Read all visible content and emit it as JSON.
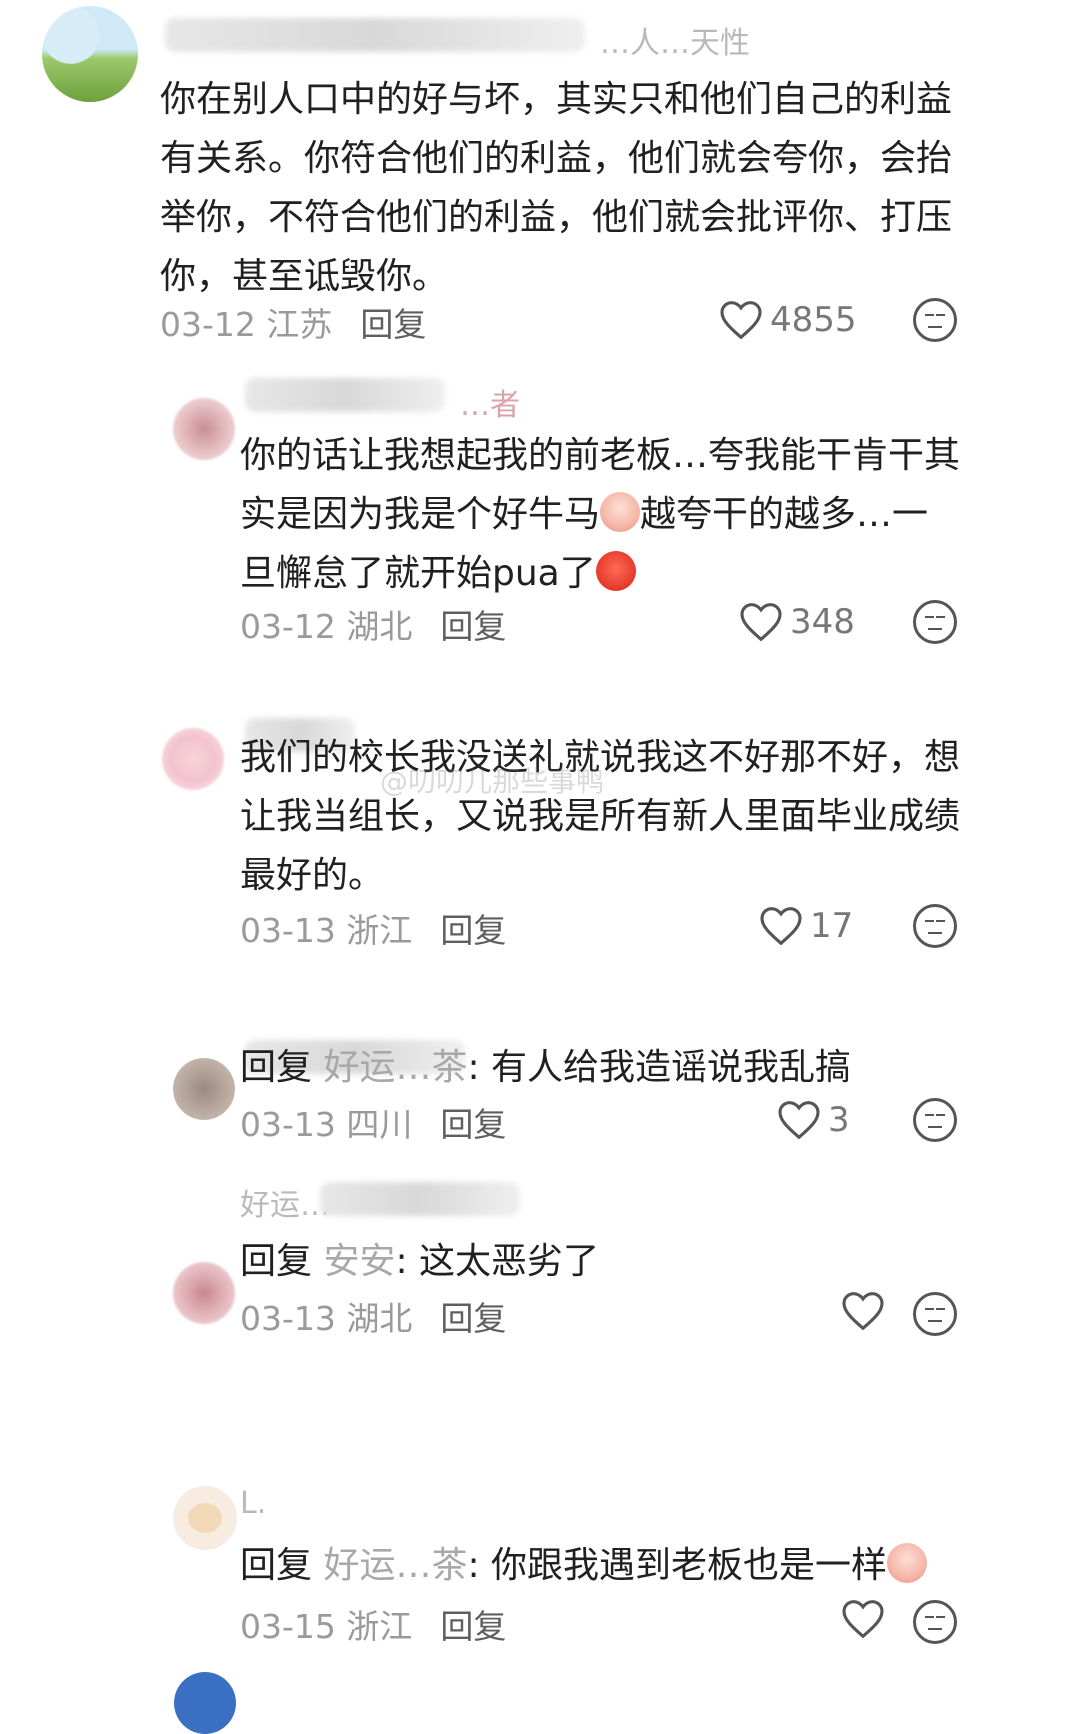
{
  "comments": [
    {
      "username_visible": "…人…天性",
      "text": "你在别人口中的好与坏，其实只和他们自己的利益有关系。你符合他们的利益，他们就会夸你，会抬举你，不符合他们的利益，他们就会批评你、打压你，甚至诋毁你。",
      "date": "03-12 江苏",
      "reply_label": "回复",
      "likes": "4855"
    },
    {
      "username_visible": "…者",
      "text_a": "你的话让我想起我的前老板…夸我能干肯干其实是因为我是个好牛马",
      "text_b": "越夸干的越多…一旦懈怠了就开始pua了",
      "date": "03-12 湖北",
      "reply_label": "回复",
      "likes": "348"
    },
    {
      "text": "我们的校长我没送礼就说我这不好那不好，想让我当组长，又说我是所有新人里面毕业成绩最好的。",
      "date": "03-13 浙江",
      "reply_label": "回复",
      "likes": "17"
    },
    {
      "reply_prefix": "回复",
      "reply_to": "好运…茶",
      "text": ": 有人给我造谣说我乱搞",
      "date": "03-13 四川",
      "reply_label": "回复",
      "likes": "3"
    },
    {
      "username_visible": "好运…",
      "reply_prefix": "回复",
      "reply_to": "安安",
      "text": ": 这太恶劣了",
      "date": "03-13 湖北",
      "reply_label": "回复",
      "likes": ""
    },
    {
      "username_visible": "L.",
      "reply_prefix": "回复",
      "reply_to": "好运…茶",
      "text": ": 你跟我遇到老板也是一样",
      "date": "03-15 浙江",
      "reply_label": "回复",
      "likes": ""
    }
  ],
  "watermark": "@叨叨儿那些事鸭",
  "colors": {
    "text": "#202020",
    "meta": "#9a9a9a",
    "reply": "#5f5f5f"
  }
}
